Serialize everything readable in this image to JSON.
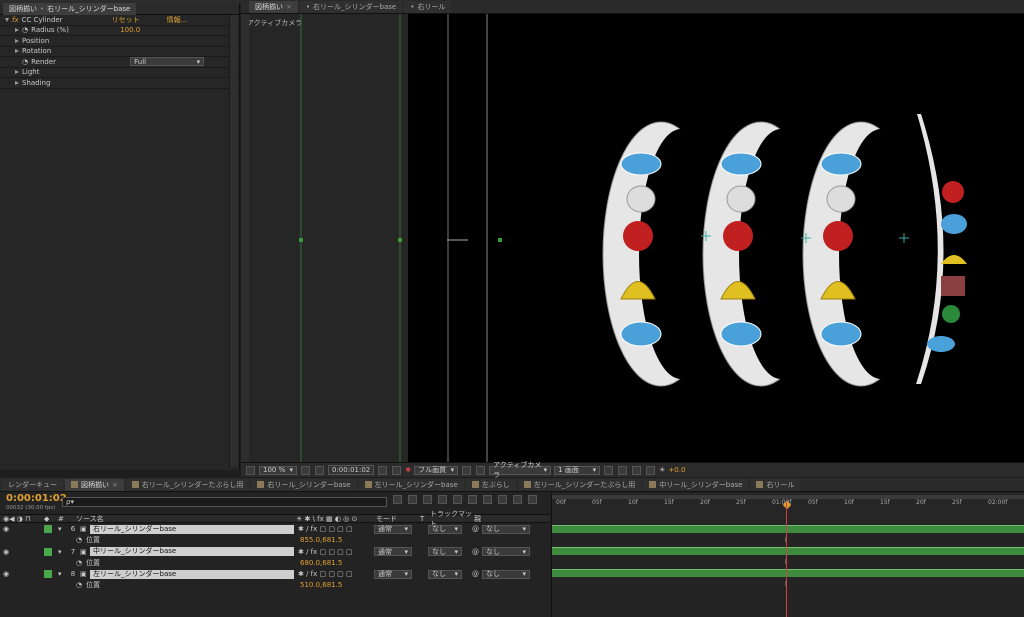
{
  "top_strip": {
    "left_text": "右リール",
    "right_text": "右リール_シリンダーbase"
  },
  "effects_panel": {
    "tab": "図柄揃い",
    "breadcrumb": "右リール_シリンダーbase",
    "effect_name": "CC Cylinder",
    "reset_label": "リセット",
    "about_label": "情報...",
    "properties": [
      {
        "label": "Radius (%)",
        "value": "100.0"
      },
      {
        "label": "Position"
      },
      {
        "label": "Rotation"
      },
      {
        "label": "Render",
        "value": "Full"
      },
      {
        "label": "Light"
      },
      {
        "label": "Shading"
      }
    ]
  },
  "comp_viewer": {
    "tabs": [
      "図柄揃い",
      "右リール_シリンダーbase",
      "右リール"
    ],
    "active_camera_label": "アクティブカメラ",
    "footer": {
      "zoom": "100 %",
      "timecode": "0:00:01:02",
      "resolution": "フル画質",
      "camera": "アクティブカメラ",
      "views": "1 画面",
      "exposure": "+0.0"
    }
  },
  "timeline": {
    "tabs": [
      "レンダーキュー",
      "図柄揃い",
      "右リール_シリンダーたぶらし用",
      "右リール_シリンダーbase",
      "左リール_シリンダーbase",
      "左ぶらし",
      "左リール_シリンダーたぶらし用",
      "中リール_シリンダーbase",
      "右リール"
    ],
    "current_time": "0:00:01:02",
    "fps_text": "00032 (30.00 fps)",
    "search_placeholder": "ρ▾",
    "columns": {
      "num": "#",
      "source": "ソース名",
      "mode": "モード",
      "t": "T",
      "trkmat": "トラックマット",
      "parent": "親"
    },
    "layers": [
      {
        "num": "6",
        "name": "右リール_シリンダーbase",
        "prop": "位置",
        "value": "855.0,681.5",
        "mode": "通常",
        "trk": "なし",
        "parent": "なし"
      },
      {
        "num": "7",
        "name": "中リール_シリンダーbase",
        "prop": "位置",
        "value": "680.0,681.5",
        "mode": "通常",
        "trk": "なし",
        "parent": "なし"
      },
      {
        "num": "8",
        "name": "左リール_シリンダーbase",
        "prop": "位置",
        "value": "510.0,681.5",
        "mode": "通常",
        "trk": "なし",
        "parent": "なし"
      }
    ],
    "ruler_labels": [
      "00f",
      "05f",
      "10f",
      "15f",
      "20f",
      "25f",
      "01:00f",
      "05f",
      "10f",
      "15f",
      "20f",
      "25f",
      "02:00f",
      "05f"
    ],
    "playhead_fraction": 0.5
  },
  "colors": {
    "accent": "#e0a030",
    "layer_green": "#4aa84a",
    "playhead": "#d04040"
  }
}
